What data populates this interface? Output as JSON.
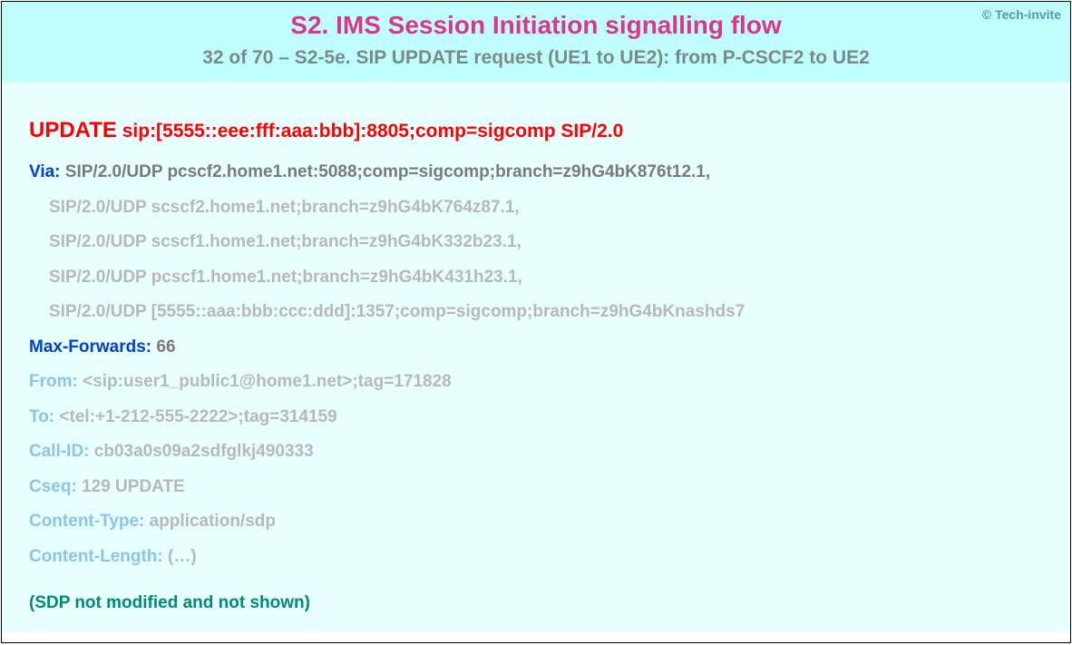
{
  "copyright": "© Tech-invite",
  "title": "S2. IMS Session Initiation signalling flow",
  "subtitle": "32 of 70 – S2-5e. SIP UPDATE request (UE1 to UE2): from P-CSCF2 to UE2",
  "request": {
    "method": "UPDATE",
    "uri_line": " sip:[5555::eee:fff:aaa:bbb]:8805;comp=sigcomp SIP/2.0"
  },
  "via": {
    "name": "Via:",
    "first": " SIP/2.0/UDP pcscf2.home1.net:5088;comp=sigcomp;branch=z9hG4bK876t12.1,",
    "cont": [
      "SIP/2.0/UDP scscf2.home1.net;branch=z9hG4bK764z87.1,",
      "SIP/2.0/UDP scscf1.home1.net;branch=z9hG4bK332b23.1,",
      "SIP/2.0/UDP pcscf1.home1.net;branch=z9hG4bK431h23.1,",
      "SIP/2.0/UDP [5555::aaa:bbb:ccc:ddd]:1357;comp=sigcomp;branch=z9hG4bKnashds7"
    ]
  },
  "max_forwards": {
    "name": "Max-Forwards:",
    "value": " 66"
  },
  "from": {
    "name": "From:",
    "value": " <sip:user1_public1@home1.net>;tag=171828"
  },
  "to": {
    "name": "To:",
    "value": " <tel:+1-212-555-2222>;tag=314159"
  },
  "call_id": {
    "name": "Call-ID:",
    "value": " cb03a0s09a2sdfglkj490333"
  },
  "cseq": {
    "name": "Cseq:",
    "value": " 129 UPDATE"
  },
  "content_type": {
    "name": "Content-Type:",
    "value": " application/sdp"
  },
  "content_length": {
    "name": "Content-Length:",
    "value": " (…)"
  },
  "note": "(SDP not modified and not shown)"
}
